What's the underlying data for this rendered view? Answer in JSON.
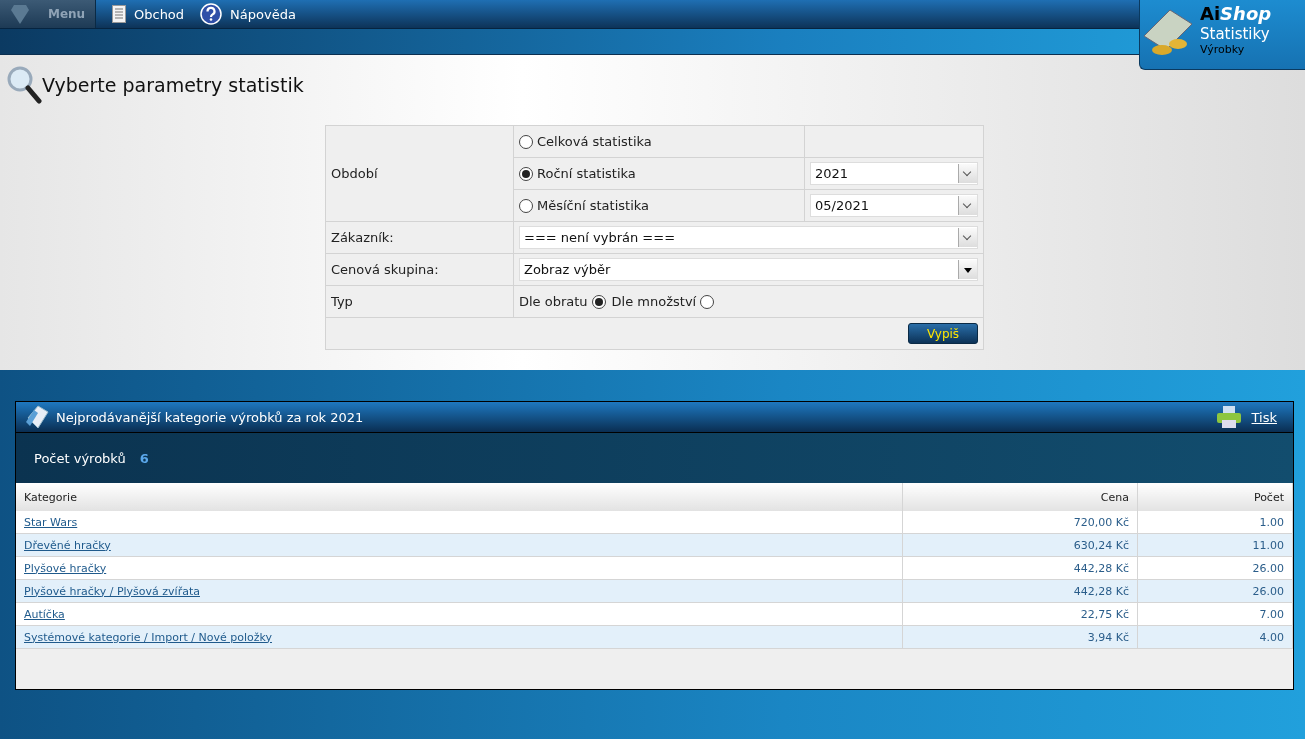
{
  "menu": {
    "label": "Menu"
  },
  "nav": [
    {
      "kind": "document",
      "label": "Obchod"
    },
    {
      "kind": "help",
      "label": "Nápověda"
    }
  ],
  "brand": {
    "name_plain": "Ai",
    "name_italic": "Shop",
    "title": "Statistiky",
    "subtitle": "Výrobky"
  },
  "heading": "Vyberte parametry statistik",
  "form": {
    "period_label": "Období",
    "period_options": [
      {
        "label": "Celková statistika",
        "selected": false
      },
      {
        "label": "Roční statistika",
        "selected": true,
        "select_value": "2021"
      },
      {
        "label": "Měsíční statistika",
        "selected": false,
        "select_value": "05/2021"
      }
    ],
    "customer": {
      "label": "Zákazník:",
      "value": "=== není vybrán ==="
    },
    "price_group": {
      "label": "Cenová skupina:",
      "value": "Zobraz výběr"
    },
    "type": {
      "label": "Typ",
      "options": [
        {
          "label": "Dle obratu",
          "selected": true
        },
        {
          "label": "Dle množství",
          "selected": false
        }
      ]
    },
    "submit": "Vypiš"
  },
  "report": {
    "title": "Nejprodávanější kategorie výrobků za rok 2021",
    "print": "Tisk",
    "count_label": "Počet výrobků",
    "count_value": "6",
    "columns": [
      "Kategorie",
      "Cena",
      "Počet"
    ],
    "rows": [
      [
        "Star Wars",
        "720,00 Kč",
        "1.00"
      ],
      [
        "Dřevěné hračky",
        "630,24 Kč",
        "11.00"
      ],
      [
        "Plyšové hračky",
        "442,28 Kč",
        "26.00"
      ],
      [
        "Plyšové hračky / Plyšová zvířata",
        "442,28 Kč",
        "26.00"
      ],
      [
        "Autíčka",
        "22,75 Kč",
        "7.00"
      ],
      [
        "Systémové kategorie / Import / Nové položky",
        "3,94 Kč",
        "4.00"
      ]
    ]
  }
}
